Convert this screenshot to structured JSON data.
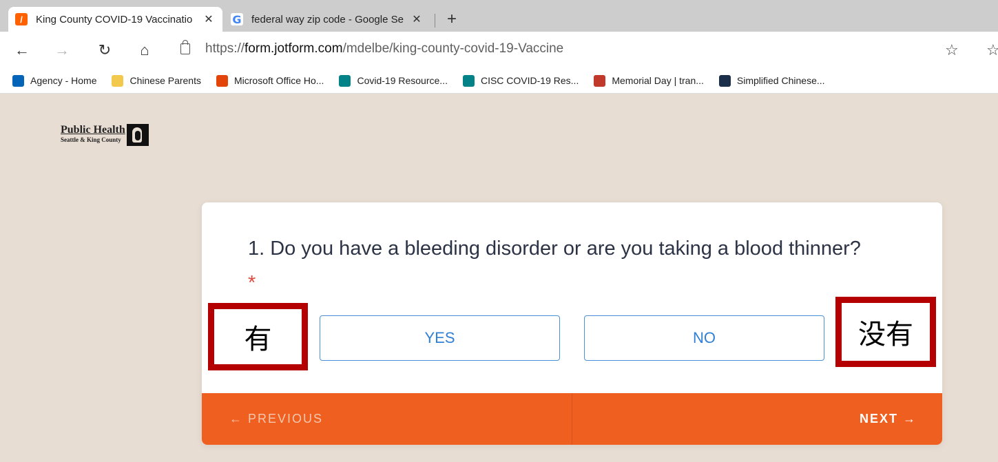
{
  "tabs": [
    {
      "title": "King County COVID-19 Vaccinatio",
      "favicon": "jotform-icon",
      "active": true
    },
    {
      "title": "federal way zip code - Google Se",
      "favicon": "google-icon",
      "active": false
    }
  ],
  "tab_close": "✕",
  "new_tab": "+",
  "address": {
    "prefix": "https://",
    "host": "form.jotform.com",
    "path": "/mdelbe/king-county-covid-19-Vaccine"
  },
  "nav_icons": {
    "back": "←",
    "forward": "→",
    "refresh": "↻",
    "home": "⌂"
  },
  "bookmarks": [
    {
      "label": "Agency - Home",
      "icon": "sharepoint-icon",
      "color": "#0364b8"
    },
    {
      "label": "Chinese Parents",
      "icon": "folder-icon",
      "color": "#f2c94c"
    },
    {
      "label": "Microsoft Office Ho...",
      "icon": "office-icon",
      "color": "#e3440a"
    },
    {
      "label": "Covid-19 Resource...",
      "icon": "sharepoint-icon",
      "color": "#038387"
    },
    {
      "label": "CISC COVID-19 Res...",
      "icon": "sharepoint-icon",
      "color": "#038387"
    },
    {
      "label": "Memorial Day | tran...",
      "icon": "shield-icon",
      "color": "#c0392b"
    },
    {
      "label": "Simplified Chinese...",
      "icon": "image-icon",
      "color": "#1b2f4a"
    }
  ],
  "logo": {
    "main": "Public Health",
    "sub": "Seattle & King County"
  },
  "form": {
    "question": "1. Do you have a bleeding disorder or are you taking a blood thinner?",
    "required_mark": "*",
    "yes_label": "YES",
    "no_label": "NO",
    "previous_label": "← PREVIOUS",
    "next_label": "NEXT →"
  },
  "annotations": {
    "left": "有",
    "right": "没有"
  },
  "colors": {
    "accent": "#ef5f1f",
    "button_border": "#4a90d9",
    "annotation_border": "#b40000",
    "page_bg": "#e8ddd3"
  }
}
